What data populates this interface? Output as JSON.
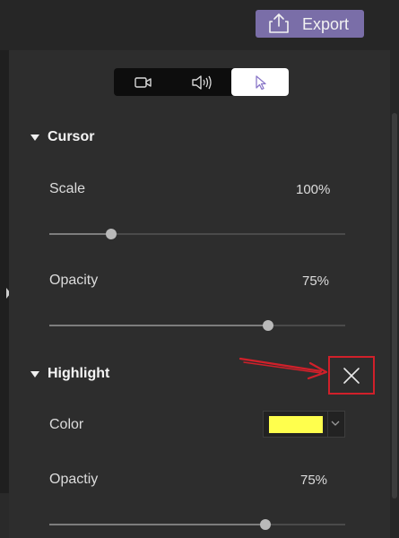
{
  "header": {
    "export_label": "Export",
    "export_icon": "share-upload-icon"
  },
  "tabs": [
    {
      "icon": "video-camera-icon",
      "active": false
    },
    {
      "icon": "speaker-icon",
      "active": false
    },
    {
      "icon": "cursor-pointer-icon",
      "active": true
    }
  ],
  "cursor_section": {
    "title": "Cursor",
    "scale": {
      "label": "Scale",
      "value": "100%",
      "level": 0.21
    },
    "opacity": {
      "label": "Opacity",
      "value": "75%",
      "level": 0.74
    }
  },
  "highlight_section": {
    "title": "Highlight",
    "color": {
      "label": "Color",
      "swatch": "#ffff4d"
    },
    "opacity": {
      "label": "Opactiy",
      "value": "75%",
      "level": 0.73
    }
  },
  "annotation": {
    "color": "#d0202a",
    "target": "close-icon"
  },
  "colors": {
    "accent": "#7a6ea8",
    "panel": "#2d2d2d"
  }
}
